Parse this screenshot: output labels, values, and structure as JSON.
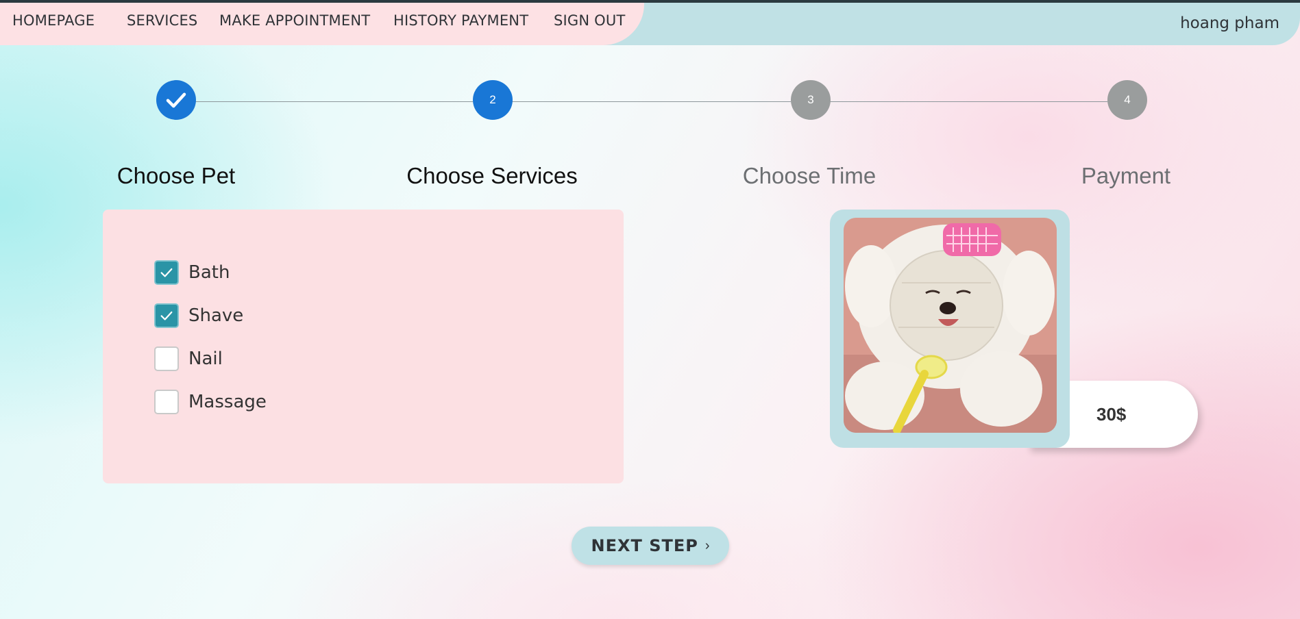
{
  "nav": {
    "homepage": "HOMEPAGE",
    "services": "SERVICES",
    "make_appointment": "MAKE APPOINTMENT",
    "history_payment": "HISTORY PAYMENT",
    "sign_out": "SIGN OUT",
    "user_name": "hoang pham"
  },
  "steps": [
    {
      "number": "1",
      "label": "Choose Pet",
      "status": "completed"
    },
    {
      "number": "2",
      "label": "Choose Services",
      "status": "active"
    },
    {
      "number": "3",
      "label": "Choose Time",
      "status": "pending"
    },
    {
      "number": "4",
      "label": "Payment",
      "status": "pending"
    }
  ],
  "services": [
    {
      "label": "Bath",
      "checked": true
    },
    {
      "label": "Shave",
      "checked": true
    },
    {
      "label": "Nail",
      "checked": false
    },
    {
      "label": "Massage",
      "checked": false
    }
  ],
  "price": "30$",
  "next_button": "NEXT STEP",
  "colors": {
    "active_step": "#1977d6",
    "pending_step": "#9a9d9d",
    "checkbox_checked": "#2a94a6",
    "nav_pink": "#fde1e4",
    "nav_teal": "#c0e1e5"
  }
}
